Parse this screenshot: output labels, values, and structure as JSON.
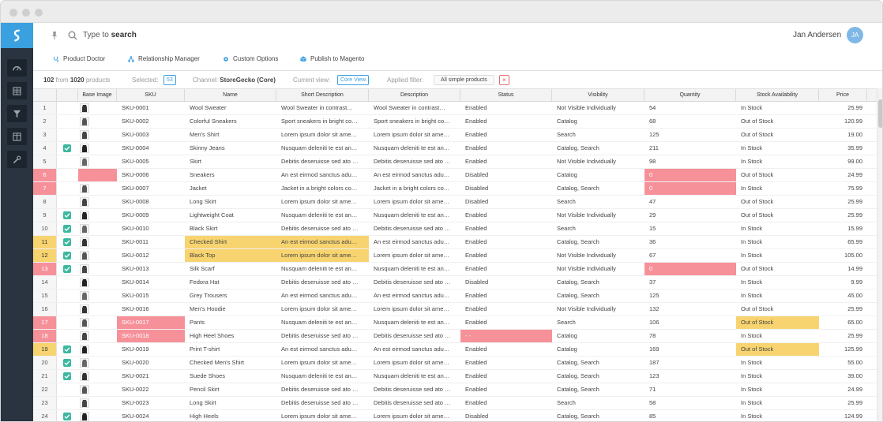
{
  "search": {
    "prefix": "Type to",
    "emphasis": "search"
  },
  "user": {
    "name": "Jan Andersen",
    "initials": "JA"
  },
  "nav": [
    {
      "label": "Product Doctor",
      "icon": "stethoscope-icon"
    },
    {
      "label": "Relationship Manager",
      "icon": "hierarchy-icon"
    },
    {
      "label": "Custom Options",
      "icon": "gear-icon"
    },
    {
      "label": "Publish to Magento",
      "icon": "cube-icon"
    }
  ],
  "info": {
    "count": "102",
    "from_label": "from",
    "total": "1020",
    "total_label": "products",
    "selected_label": "Selected:",
    "selected_value": "53",
    "channel_label": "Channel:",
    "channel_value": "StoreGecko (Core)",
    "view_label": "Current view:",
    "view_value": "Core View",
    "filter_label": "Applied filter:",
    "filter_value": "All simple products",
    "filter_clear": "×"
  },
  "columns": [
    "Base Image",
    "SKU",
    "Name",
    "Short Description",
    "Description",
    "Status",
    "Visibility",
    "Quantity",
    "Stock Availability",
    "Price"
  ],
  "rows": [
    {
      "n": "1",
      "chk": false,
      "sku": "SKU-0001",
      "name": "Wool Sweater",
      "short": "Wool Sweater in contrast…",
      "desc": "Wool Sweater in contrast…",
      "status": "Enabled",
      "vis": "Not Visible Individually",
      "qty": "54",
      "stock": "In Stock",
      "price": "25.99"
    },
    {
      "n": "2",
      "chk": false,
      "sku": "SKU-0002",
      "name": "Colorful Sneakers",
      "short": "Sport sneakers in bright co…",
      "desc": "Sport sneakers in bright co…",
      "status": "Enabled",
      "vis": "Catalog",
      "qty": "68",
      "stock": "Out of Stock",
      "price": "120.99"
    },
    {
      "n": "3",
      "chk": false,
      "sku": "SKU-0003",
      "name": "Men's Shirt",
      "short": "Lorem ipsum dolor sit ame…",
      "desc": "Lorem ipsum dolor sit ame…",
      "status": "Enabled",
      "vis": "Search",
      "qty": "125",
      "stock": "Out of Stock",
      "price": "19.00"
    },
    {
      "n": "4",
      "chk": true,
      "sku": "SKU-0004",
      "name": "Skinny Jeans",
      "short": "Nusquam deleniti te est an…",
      "desc": "Nusquam deleniti te est an…",
      "status": "Enabled",
      "vis": "Catalog, Search",
      "qty": "211",
      "stock": "In Stock",
      "price": "35.99"
    },
    {
      "n": "5",
      "chk": false,
      "sku": "SKU-0005",
      "name": "Skirt",
      "short": "Debitis deseruisse sed ato …",
      "desc": "Debitis deseruisse sed ato …",
      "status": "Enabled",
      "vis": "Not Visible Individually",
      "qty": "98",
      "stock": "In Stock",
      "price": "99.00"
    },
    {
      "n": "6",
      "chk": false,
      "sku": "SKU-0006",
      "name": "Sneakers",
      "short": "An est eirmod sanctus adu…",
      "desc": "An est eirmod sanctus adu…",
      "status": "Disabled",
      "vis": "Catalog",
      "qty": "0",
      "stock": "Out of Stock",
      "price": "24.99"
    },
    {
      "n": "7",
      "chk": false,
      "sku": "SKU-0007",
      "name": "Jacket",
      "short": "Jacket in a bright colors co…",
      "desc": "Jacket in a bright colors co…",
      "status": "Disabled",
      "vis": "Catalog, Search",
      "qty": "0",
      "stock": "In Stock",
      "price": "75.99"
    },
    {
      "n": "8",
      "chk": false,
      "sku": "SKU-0008",
      "name": "Long Skirt",
      "short": "Lorem ipsum dolor sit ame…",
      "desc": "Lorem ipsum dolor sit ame…",
      "status": "Disabled",
      "vis": "Search",
      "qty": "47",
      "stock": "Out of Stock",
      "price": "25.99"
    },
    {
      "n": "9",
      "chk": true,
      "sku": "SKU-0009",
      "name": "Lightweight Coat",
      "short": "Nusquam deleniti te est an…",
      "desc": "Nusquam deleniti te est an…",
      "status": "Enabled",
      "vis": "Not Visible Individually",
      "qty": "29",
      "stock": "Out of Stock",
      "price": "25.99"
    },
    {
      "n": "10",
      "chk": true,
      "sku": "SKU-0010",
      "name": "Black Skirt",
      "short": "Debitis deseruisse sed ato …",
      "desc": "Debitis deseruisse sed ato …",
      "status": "Enabled",
      "vis": "Search",
      "qty": "15",
      "stock": "In Stock",
      "price": "15.99"
    },
    {
      "n": "11",
      "chk": true,
      "sku": "SKU-0011",
      "name": "Checked Shirt",
      "short": "An est eirmod sanctus adu…",
      "desc": "An est eirmod sanctus adu…",
      "status": "Enabled",
      "vis": "Catalog, Search",
      "qty": "36",
      "stock": "In Stock",
      "price": "65.99"
    },
    {
      "n": "12",
      "chk": true,
      "sku": "SKU-0012",
      "name": "Black Top",
      "short": "Lorem ipsum dolor sit ame…",
      "desc": "Lorem ipsum dolor sit ame…",
      "status": "Enabled",
      "vis": "Not Visible Individually",
      "qty": "67",
      "stock": "In Stock",
      "price": "105.00"
    },
    {
      "n": "13",
      "chk": true,
      "sku": "SKU-0013",
      "name": "Silk Scarf",
      "short": "Nusquam deleniti te est an…",
      "desc": "Nusquam deleniti te est an…",
      "status": "Enabled",
      "vis": "Not Visible Individually",
      "qty": "0",
      "stock": "Out of Stock",
      "price": "14.99"
    },
    {
      "n": "14",
      "chk": false,
      "sku": "SKU-0014",
      "name": "Fedora Hat",
      "short": "Debitis deseruisse sed ato …",
      "desc": "Debitis deseruisse sed ato …",
      "status": "Disabled",
      "vis": "Catalog, Search",
      "qty": "37",
      "stock": "In Stock",
      "price": "9.99"
    },
    {
      "n": "15",
      "chk": false,
      "sku": "SKU-0015",
      "name": "Grey Trousers",
      "short": "An est eirmod sanctus adu…",
      "desc": "An est eirmod sanctus adu…",
      "status": "Enabled",
      "vis": "Catalog, Search",
      "qty": "125",
      "stock": "In Stock",
      "price": "45.00"
    },
    {
      "n": "16",
      "chk": false,
      "sku": "SKU-0016",
      "name": "Men's Hoodie",
      "short": "Lorem ipsum dolor sit ame…",
      "desc": "Lorem ipsum dolor sit ame…",
      "status": "Enabled",
      "vis": "Not Visible Individually",
      "qty": "132",
      "stock": "Out of Stock",
      "price": "25.99"
    },
    {
      "n": "17",
      "chk": false,
      "sku": "SKU-0017",
      "name": "Pants",
      "short": "Nusquam deleniti te est an…",
      "desc": "Nusquam deleniti te est an…",
      "status": "Enabled",
      "vis": "Search",
      "qty": "106",
      "stock": "Out of Stock",
      "price": "65.00"
    },
    {
      "n": "18",
      "chk": false,
      "sku": "SKU-0018",
      "name": "High Heel Shoes",
      "short": "Debitis deseruisse sed ato …",
      "desc": "Debitis deseruisse sed ato …",
      "status": "- -",
      "vis": "Catalog",
      "qty": "78",
      "stock": "In Stock",
      "price": "25.99"
    },
    {
      "n": "19",
      "chk": true,
      "sku": "SKU-0019",
      "name": "Print T-shirt",
      "short": "An est eirmod sanctus adu…",
      "desc": "An est eirmod sanctus adu…",
      "status": "Enabled",
      "vis": "Catalog",
      "qty": "169",
      "stock": "Out of Stock",
      "price": "125.99"
    },
    {
      "n": "20",
      "chk": true,
      "sku": "SKU-0020",
      "name": "Checked Men's Shirt",
      "short": "Lorem ipsum dolor sit ame…",
      "desc": "Lorem ipsum dolor sit ame…",
      "status": "Enabled",
      "vis": "Catalog, Search",
      "qty": "187",
      "stock": "In Stock",
      "price": "55.00"
    },
    {
      "n": "21",
      "chk": true,
      "sku": "SKU-0021",
      "name": "Suede Shoes",
      "short": "Nusquam deleniti te est an…",
      "desc": "Nusquam deleniti te est an…",
      "status": "Enabled",
      "vis": "Catalog, Search",
      "qty": "123",
      "stock": "In Stock",
      "price": "39.00"
    },
    {
      "n": "22",
      "chk": false,
      "sku": "SKU-0022",
      "name": "Pencil Skirt",
      "short": "Debitis deseruisse sed ato …",
      "desc": "Debitis deseruisse sed ato …",
      "status": "Enabled",
      "vis": "Catalog, Search",
      "qty": "71",
      "stock": "In Stock",
      "price": "24.99"
    },
    {
      "n": "23",
      "chk": false,
      "sku": "SKU-0023",
      "name": "Long Skirt",
      "short": "Debitis deseruisse sed ato …",
      "desc": "Debitis deseruisse sed ato …",
      "status": "Enabled",
      "vis": "Search",
      "qty": "58",
      "stock": "In Stock",
      "price": "25.99"
    },
    {
      "n": "24",
      "chk": true,
      "sku": "SKU-0024",
      "name": "High Heels",
      "short": "Lorem ipsum dolor sit ame…",
      "desc": "Lorem ipsum dolor sit ame…",
      "status": "Disabled",
      "vis": "Catalog, Search",
      "qty": "85",
      "stock": "In Stock",
      "price": "124.99"
    }
  ],
  "highlights": {
    "row_error": [
      "6",
      "7",
      "13",
      "17",
      "18"
    ],
    "row_warn": [
      "11",
      "12",
      "19"
    ],
    "err_cells": [
      [
        "6",
        "img"
      ],
      [
        "6",
        "qty"
      ],
      [
        "7",
        "qty"
      ],
      [
        "13",
        "qty"
      ],
      [
        "17",
        "sku"
      ],
      [
        "18",
        "sku"
      ],
      [
        "18",
        "status"
      ]
    ],
    "warn_cells": [
      [
        "11",
        "name"
      ],
      [
        "11",
        "short"
      ],
      [
        "12",
        "name"
      ],
      [
        "12",
        "short"
      ],
      [
        "17",
        "stock"
      ],
      [
        "19",
        "stock"
      ]
    ]
  },
  "colors": {
    "accent": "#3aa0e0",
    "error": "#f6919a",
    "warning": "#f8d470",
    "check": "#3cb8a0",
    "rail": "#2a3440"
  }
}
